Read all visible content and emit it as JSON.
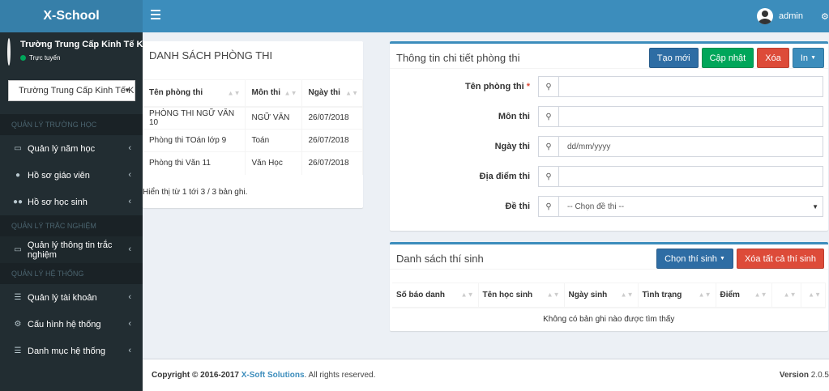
{
  "header": {
    "logo": "X-School",
    "username": "admin"
  },
  "sidebar": {
    "user_name": "Trường Trung Cấp Kinh Tế K",
    "user_status": "Trực tuyến",
    "school_select": "Trường Trung Cấp Kinh Tế K",
    "sections": [
      {
        "header": "QUẢN LÝ TRƯỜNG HỌC",
        "items": [
          {
            "label": "Quản lý năm học",
            "icon": "laptop-icon"
          },
          {
            "label": "Hồ sơ giáo viên",
            "icon": "user-icon"
          },
          {
            "label": "Hồ sơ học sinh",
            "icon": "users-icon"
          }
        ]
      },
      {
        "header": "QUẢN LÝ TRẮC NGHIỆM",
        "items": [
          {
            "label": "Quản lý thông tin trắc nghiệm",
            "icon": "laptop-icon"
          }
        ]
      },
      {
        "header": "QUẢN LÝ HỆ THỐNG",
        "items": [
          {
            "label": "Quản lý tài khoản",
            "icon": "bars-icon"
          },
          {
            "label": "Cấu hình hệ thống",
            "icon": "gear-icon"
          },
          {
            "label": "Danh mục hệ thống",
            "icon": "bars-icon"
          }
        ]
      }
    ]
  },
  "exam_rooms": {
    "title": "DANH SÁCH PHÒNG THI",
    "columns": [
      "Tên phòng thi",
      "Môn thi",
      "Ngày thi"
    ],
    "rows": [
      [
        "PHÒNG THI NGỮ VĂN 10",
        "NGỮ VĂN",
        "26/07/2018"
      ],
      [
        "Phòng thi TOán lớp 9",
        "Toán",
        "26/07/2018"
      ],
      [
        "Phòng thi Văn 11",
        "Văn Học",
        "26/07/2018"
      ]
    ],
    "info": "Hiển thị từ 1 tới 3 / 3 bản ghi."
  },
  "detail": {
    "title": "Thông tin chi tiết phòng thi",
    "buttons": {
      "create": "Tạo mới",
      "update": "Cập nhật",
      "delete": "Xóa",
      "print": "In"
    },
    "fields": {
      "room_name": {
        "label": "Tên phòng thi",
        "required_mark": "*",
        "value": ""
      },
      "subject": {
        "label": "Môn thi",
        "value": ""
      },
      "date": {
        "label": "Ngày thi",
        "placeholder": "dd/mm/yyyy"
      },
      "location": {
        "label": "Địa điểm thi",
        "value": ""
      },
      "exam": {
        "label": "Đề thi",
        "selected": "-- Chọn đề thi --"
      }
    }
  },
  "candidates": {
    "title": "Danh sách thí sinh",
    "select_button": "Chọn thí sinh",
    "delete_all_button": "Xóa tất cả thí sinh",
    "columns": [
      "Số báo danh",
      "Tên học sinh",
      "Ngày sinh",
      "Tình trạng",
      "Điểm",
      "",
      ""
    ],
    "empty_message": "Không có bản ghi nào được tìm thấy"
  },
  "footer": {
    "copyright_prefix": "Copyright © 2016-2017",
    "brand": "X-Soft Solutions",
    "copyright_suffix": ". All rights reserved.",
    "version_label": "Version",
    "version": "2.0.5"
  },
  "colors": {
    "header": "#3c8dbc",
    "logo_bg": "#367fa9",
    "sidebar": "#222d32",
    "success": "#00a65a",
    "danger": "#dd4b39"
  }
}
